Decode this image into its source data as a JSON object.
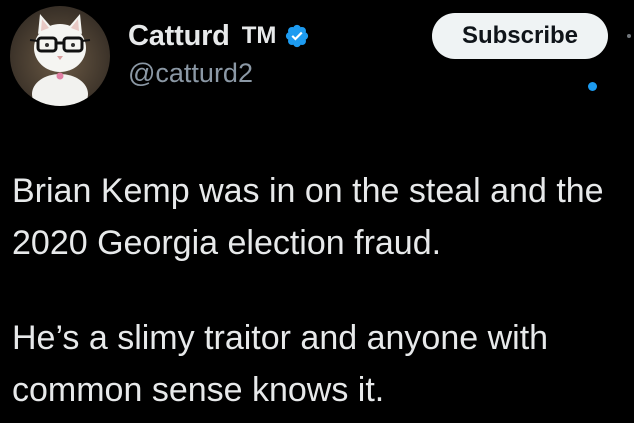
{
  "author": {
    "display_name": "Catturd",
    "tm": "TM",
    "handle": "@catturd2",
    "verified_icon": "verified-badge-icon",
    "avatar_icon": "cat-with-glasses-avatar"
  },
  "actions": {
    "subscribe_label": "Subscribe"
  },
  "tweet": {
    "paragraph_1": "Brian Kemp was in on the steal and the 2020 Georgia election fraud.",
    "paragraph_2": "He’s a slimy traitor and anyone with common sense knows it."
  },
  "colors": {
    "background": "#000000",
    "text_primary": "#e7e9ea",
    "text_secondary": "#8b98a5",
    "accent": "#1d9bf0",
    "button_bg": "#eff3f4"
  }
}
